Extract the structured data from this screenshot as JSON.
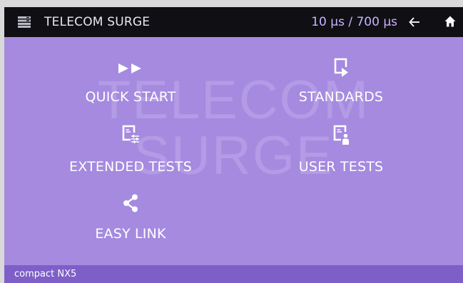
{
  "header": {
    "title": "TELECOM SURGE",
    "waveform": "10 µs / 700 µs",
    "menu_icon": "menu-icon",
    "back_icon": "arrow-left-icon",
    "home_icon": "home-icon"
  },
  "watermark": {
    "line1": "TELECOM",
    "line2": "SURGE"
  },
  "tiles": [
    {
      "label": "QUICK START",
      "icon": "fast-forward-icon"
    },
    {
      "label": "STANDARDS",
      "icon": "document-play-icon"
    },
    {
      "label": "EXTENDED TESTS",
      "icon": "document-settings-icon"
    },
    {
      "label": "USER TESTS",
      "icon": "document-user-icon"
    },
    {
      "label": "EASY LINK",
      "icon": "share-icon"
    }
  ],
  "status": {
    "device": "compact NX5"
  },
  "colors": {
    "screen_bg": "#a58ae0",
    "topbar_bg": "#0f0f14",
    "statusbar_bg": "#7e5fc7",
    "accent_text": "#c9b3ff"
  }
}
